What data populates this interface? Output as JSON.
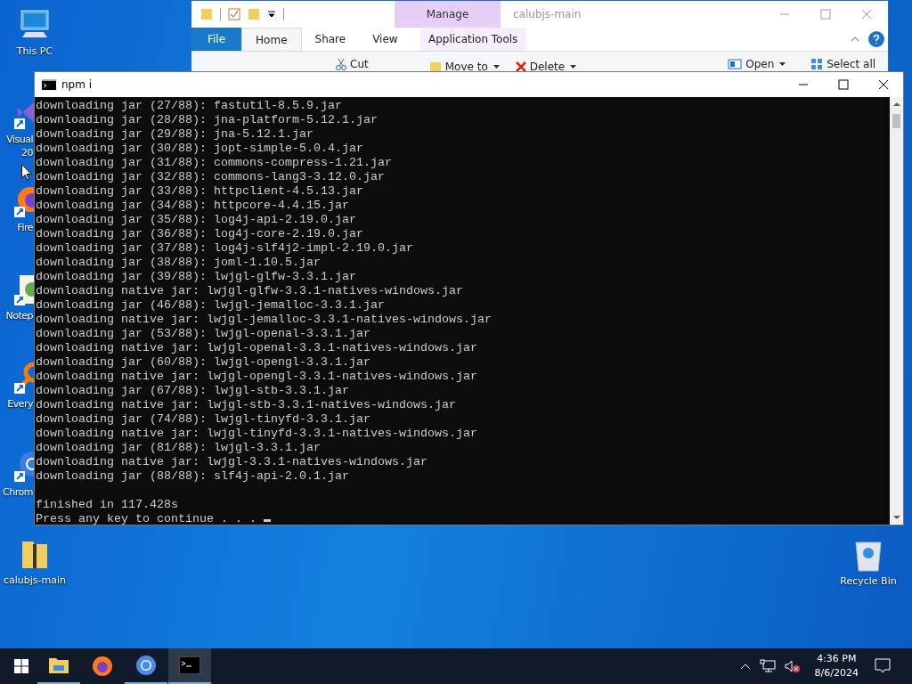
{
  "desktop": {
    "icons": [
      {
        "kind": "computer",
        "label": "This PC"
      },
      {
        "kind": "visual-studio",
        "label": "Visual 20"
      },
      {
        "kind": "firefox",
        "label": "Fire"
      },
      {
        "kind": "notepad",
        "label": "Notep"
      },
      {
        "kind": "everything",
        "label": "Every"
      },
      {
        "kind": "chrome",
        "label": "Chrom"
      },
      {
        "kind": "folder",
        "label": "calubjs-main"
      }
    ],
    "right_icons": [
      {
        "kind": "recycle-bin",
        "label": "Recycle Bin"
      }
    ]
  },
  "explorer": {
    "title": "calubjs-main",
    "context_group": "Manage",
    "tabs": [
      {
        "label": "File",
        "kind": "file",
        "selected": false
      },
      {
        "label": "Home",
        "kind": "tab",
        "selected": true
      },
      {
        "label": "Share",
        "kind": "tab",
        "selected": false
      },
      {
        "label": "View",
        "kind": "tab",
        "selected": false
      },
      {
        "label": "Application Tools",
        "kind": "context",
        "selected": false
      }
    ],
    "commands": [
      {
        "label": "Cut",
        "kind": "cut",
        "dropdown": false
      },
      {
        "label": "Move to",
        "kind": "move",
        "dropdown": true
      },
      {
        "label": "Delete",
        "kind": "delete",
        "dropdown": true
      },
      {
        "label": "Open",
        "kind": "open",
        "dropdown": true
      },
      {
        "label": "Select all",
        "kind": "select",
        "dropdown": false
      }
    ]
  },
  "terminal": {
    "title": "npm i",
    "log_lines": [
      "downloading jar (27/88): fastutil-8.5.9.jar",
      "downloading jar (28/88): jna-platform-5.12.1.jar",
      "downloading jar (29/88): jna-5.12.1.jar",
      "downloading jar (30/88): jopt-simple-5.0.4.jar",
      "downloading jar (31/88): commons-compress-1.21.jar",
      "downloading jar (32/88): commons-lang3-3.12.0.jar",
      "downloading jar (33/88): httpclient-4.5.13.jar",
      "downloading jar (34/88): httpcore-4.4.15.jar",
      "downloading jar (35/88): log4j-api-2.19.0.jar",
      "downloading jar (36/88): log4j-core-2.19.0.jar",
      "downloading jar (37/88): log4j-slf4j2-impl-2.19.0.jar",
      "downloading jar (38/88): joml-1.10.5.jar",
      "downloading jar (39/88): lwjgl-glfw-3.3.1.jar",
      "downloading native jar: lwjgl-glfw-3.3.1-natives-windows.jar",
      "downloading jar (46/88): lwjgl-jemalloc-3.3.1.jar",
      "downloading native jar: lwjgl-jemalloc-3.3.1-natives-windows.jar",
      "downloading jar (53/88): lwjgl-openal-3.3.1.jar",
      "downloading native jar: lwjgl-openal-3.3.1-natives-windows.jar",
      "downloading jar (60/88): lwjgl-opengl-3.3.1.jar",
      "downloading native jar: lwjgl-opengl-3.3.1-natives-windows.jar",
      "downloading jar (67/88): lwjgl-stb-3.3.1.jar",
      "downloading native jar: lwjgl-stb-3.3.1-natives-windows.jar",
      "downloading jar (74/88): lwjgl-tinyfd-3.3.1.jar",
      "downloading native jar: lwjgl-tinyfd-3.3.1-natives-windows.jar",
      "downloading jar (81/88): lwjgl-3.3.1.jar",
      "downloading native jar: lwjgl-3.3.1-natives-windows.jar",
      "downloading jar (88/88): slf4j-api-2.0.1.jar"
    ],
    "summary_lines": [
      "finished in 117.428s",
      "Press any key to continue . . ."
    ]
  },
  "taskbar": {
    "apps": [
      {
        "kind": "explorer",
        "selected": false,
        "running": true
      },
      {
        "kind": "firefox",
        "selected": false,
        "running": false
      },
      {
        "kind": "chrome",
        "selected": false,
        "running": true
      },
      {
        "kind": "console",
        "selected": true,
        "running": true
      }
    ],
    "time": "4:36 PM",
    "date": "8/6/2024"
  }
}
